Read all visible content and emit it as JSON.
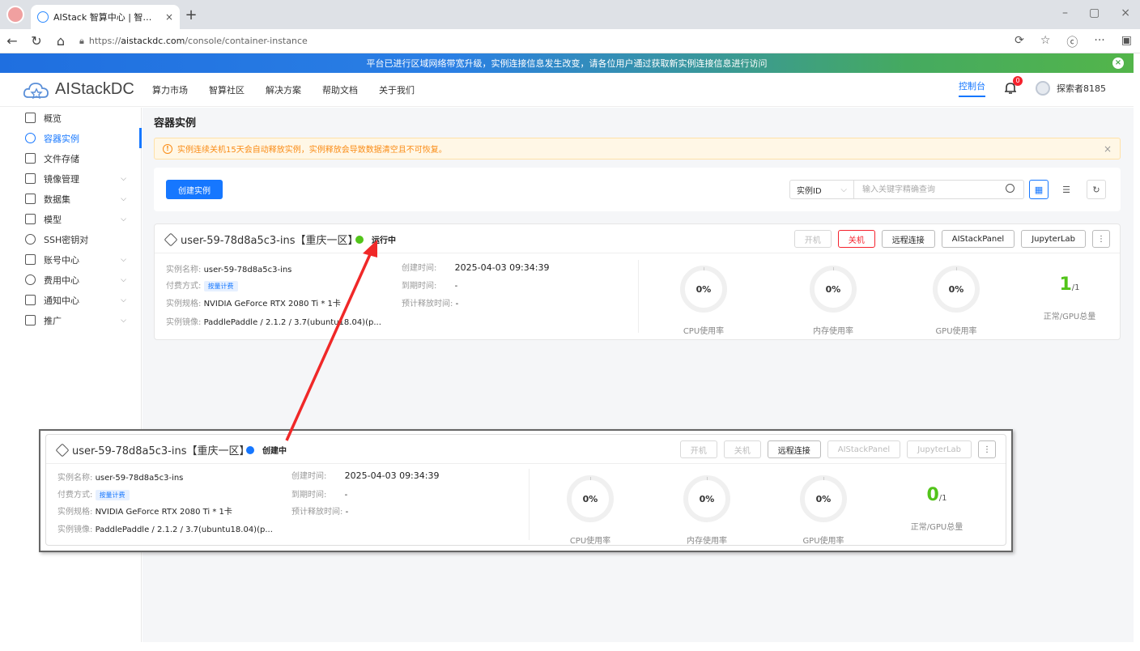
{
  "browser": {
    "tab_title": "AIStack 智算中心 | 智算随心、服务",
    "tab_close": "×",
    "new_tab": "+",
    "url_prefix": "https://",
    "url_domain": "aistackdc.com",
    "url_path": "/console/container-instance",
    "win_min": "–",
    "win_max": "▢",
    "win_close": "×",
    "more": "···"
  },
  "announcement": {
    "text": "平台已进行区域网络带宽升级，实例连接信息发生改变，请各位用户通过获取新实例连接信息进行访问",
    "close": "×"
  },
  "header": {
    "logo_text": "AIStackDC",
    "nav": [
      "算力市场",
      "智算社区",
      "解决方案",
      "帮助文档",
      "关于我们"
    ],
    "console": "控制台",
    "bell_badge": "0",
    "username": "探索者8185"
  },
  "sidebar": {
    "items": [
      {
        "label": "概览",
        "chev": ""
      },
      {
        "label": "容器实例",
        "chev": ""
      },
      {
        "label": "文件存储",
        "chev": ""
      },
      {
        "label": "镜像管理",
        "chev": "⌵"
      },
      {
        "label": "数据集",
        "chev": "⌵"
      },
      {
        "label": "模型",
        "chev": "⌵"
      },
      {
        "label": "SSH密钥对",
        "chev": ""
      },
      {
        "label": "账号中心",
        "chev": "⌵"
      },
      {
        "label": "费用中心",
        "chev": "⌵"
      },
      {
        "label": "通知中心",
        "chev": "⌵"
      },
      {
        "label": "推广",
        "chev": "⌵"
      }
    ]
  },
  "main": {
    "title": "容器实例",
    "warning": "实例连续关机15天会自动释放实例，实例释放会导致数据清空且不可恢复。",
    "warning_icon": "!",
    "warning_close": "×",
    "create_button": "创建实例",
    "filter_value": "实例ID",
    "filter_chev": "⌵",
    "search_placeholder": "输入关键字精确查询",
    "view_card": "▦",
    "view_list": "☰",
    "refresh": "↻"
  },
  "instance": {
    "name": "user-59-78d8a5c3-ins【重庆一区】",
    "status": "运行中",
    "status_color": "#52c41a",
    "actions": {
      "start": "开机",
      "stop": "关机",
      "remote": "远程连接",
      "panel": "AIStackPanel",
      "jupyter": "JupyterLab",
      "more": "⋮"
    },
    "labels": {
      "name": "实例名称:",
      "billing": "付费方式:",
      "spec": "实例规格:",
      "image": "实例镜像:",
      "created": "创建时间:",
      "expire": "到期时间:",
      "release": "预计释放时间:"
    },
    "values": {
      "name": "user-59-78d8a5c3-ins",
      "billing": "按量计费",
      "spec": "NVIDIA GeForce RTX 2080 Ti * 1卡",
      "image": "PaddlePaddle / 2.1.2 / 3.7(ubuntu18.04)(p...",
      "created": "2025-04-03 09:34:39",
      "expire": "-",
      "release": "-"
    },
    "metrics": {
      "cpu": "0%",
      "cpu_label": "CPU使用率",
      "mem": "0%",
      "mem_label": "内存使用率",
      "gpu": "0%",
      "gpu_label": "GPU使用率",
      "gpu_ok": "1",
      "gpu_total": "/1",
      "gpu_count_label": "正常/GPU总量"
    }
  },
  "zoom_instance": {
    "name": "user-59-78d8a5c3-ins【重庆一区】",
    "status": "创建中",
    "status_color": "#1677ff",
    "gpu_ok": "0",
    "gpu_total": "/1"
  }
}
